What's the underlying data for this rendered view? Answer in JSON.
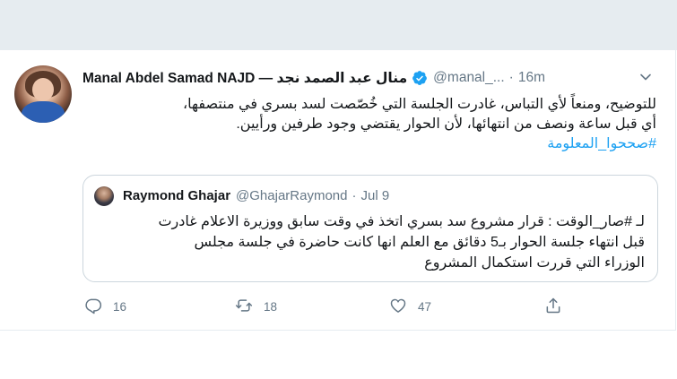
{
  "tweet": {
    "display_name": "Manal Abdel Samad NAJD — منال عبد الصمد نجد",
    "handle": "@manal_...",
    "separator": "·",
    "time": "16m",
    "text_lines": [
      "للتوضيح، ومنعاً لأي التباس، غادرت الجلسة التي خُصّصت لسد بسري في منتصفها،",
      "أي قبل ساعة ونصف من انتهائها، لأن الحوار يقتضي وجود طرفين ورأيين."
    ],
    "hashtag": "#صححوا_المعلومة",
    "verified_icon": "verified-badge-icon",
    "colors": {
      "accent": "#1da1f2",
      "muted": "#657786",
      "border": "#ccd6dd",
      "top_strip": "#e6ecf0"
    }
  },
  "quoted": {
    "display_name": "Raymond Ghajar",
    "handle": "@GhajarRaymond",
    "separator": "·",
    "date": "Jul 9",
    "text_lines": [
      "لـ #صار_الوقت :  قرار مشروع سد بسري اتخذ في وقت سابق ووزيرة الاعلام غادرت",
      "قبل انتهاء جلسة الحوار بـ5 دقائق مع العلم انها كانت حاضرة في جلسة مجلس",
      "الوزراء التي قررت استكمال المشروع"
    ]
  },
  "actions": {
    "reply_count": "16",
    "retweet_count": "18",
    "like_count": "47",
    "icons": [
      "reply-icon",
      "retweet-icon",
      "like-icon",
      "share-icon"
    ]
  }
}
